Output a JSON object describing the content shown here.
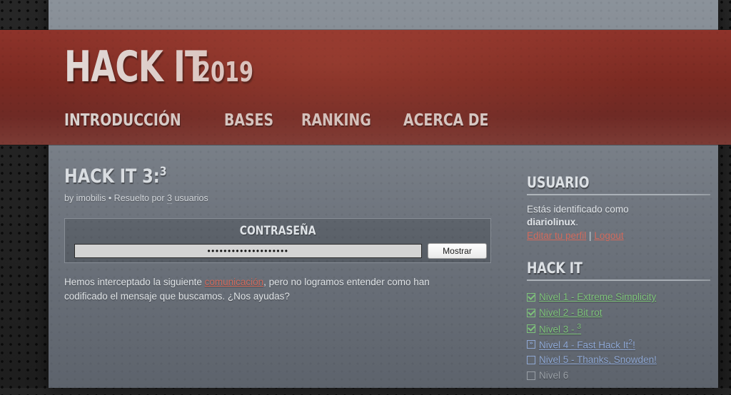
{
  "site": {
    "logo_main": "HACK IT",
    "logo_year": "2019",
    "nav": [
      {
        "label": "Introducción"
      },
      {
        "label": "Bases"
      },
      {
        "label": "Ranking"
      },
      {
        "label": "Acerca de"
      }
    ]
  },
  "main": {
    "title": "HACK IT 3:",
    "title_sup": "3",
    "byline_prefix": "by imobilis • Resuelto por ",
    "byline_count": "3",
    "byline_suffix": " usuarios",
    "password": {
      "legend": "Contraseña",
      "value": "••••••••••••••••••••",
      "placeholder": "",
      "show_label": "Mostrar"
    },
    "description_pre": "Hemos interceptado la siguiente ",
    "description_link": "comunicación",
    "description_post": ", pero no logramos entender como han codificado el mensaje que buscamos. ¿Nos ayudas?"
  },
  "sidebar": {
    "user_heading": "Usuario",
    "user_line": "Estás identificado como",
    "user_name": "diariolinux",
    "user_name_period": ".",
    "edit_profile_label": "Editar tu perfil",
    "links_separator": " | ",
    "logout_label": "Logout",
    "levels_heading": "Hack It",
    "levels": [
      {
        "label": "Nivel 1 - Extreme Simplicity",
        "state": "solved",
        "marker": "check"
      },
      {
        "label": "Nivel 2 - Bit rot",
        "state": "solved",
        "marker": "check"
      },
      {
        "label": "Nivel 3 - ",
        "sup": "3",
        "state": "solved",
        "marker": "check"
      },
      {
        "label": "Nivel 4 - Fast Hack It",
        "sup": "2",
        "suffix": "!",
        "state": "current",
        "marker": "»"
      },
      {
        "label": "Nivel 5 - Thanks, Snowden!",
        "state": "open",
        "marker": ""
      },
      {
        "label": "Nivel 6",
        "state": "locked",
        "marker": ""
      }
    ]
  },
  "colors": {
    "banner": "#7e2b23",
    "link": "#d06a5c",
    "solved": "#7ec37a",
    "available": "#8fa8d4",
    "locked": "#9aa0a7"
  }
}
